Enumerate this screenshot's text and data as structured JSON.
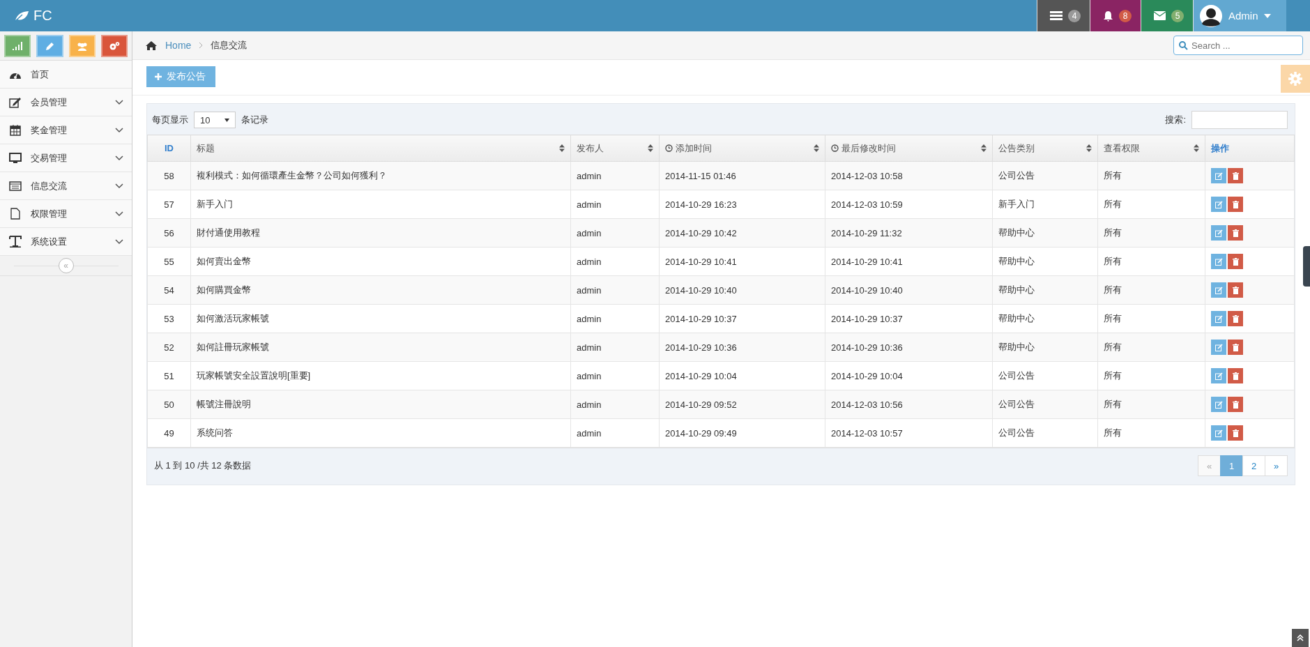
{
  "brand": "FC",
  "topbar": {
    "badges": [
      {
        "count": "4",
        "color": "#555555"
      },
      {
        "count": "8",
        "color": "#8a2463"
      },
      {
        "count": "5",
        "color": "#2a8a5a"
      }
    ],
    "user": "Admin"
  },
  "sidebar": {
    "items": [
      {
        "label": "首页",
        "expandable": false
      },
      {
        "label": "会员管理",
        "expandable": true
      },
      {
        "label": "奖金管理",
        "expandable": true
      },
      {
        "label": "交易管理",
        "expandable": true
      },
      {
        "label": "信息交流",
        "expandable": true
      },
      {
        "label": "权限管理",
        "expandable": true
      },
      {
        "label": "系统设置",
        "expandable": true
      }
    ],
    "collapse": "«"
  },
  "breadcrumb": [
    "Home",
    "信息交流"
  ],
  "search": {
    "placeholder": "Search ..."
  },
  "add_button": "发布公告",
  "table": {
    "length_label": "每页显示",
    "length_value": "10",
    "length_suffix": "条记录",
    "search_label": "搜索:",
    "columns": [
      {
        "label": "ID",
        "kind": "id",
        "sortable": false,
        "clock": false
      },
      {
        "label": "标题",
        "kind": "text",
        "sortable": true,
        "clock": false
      },
      {
        "label": "发布人",
        "kind": "text",
        "sortable": true,
        "clock": false
      },
      {
        "label": "添加时间",
        "kind": "text",
        "sortable": true,
        "clock": true
      },
      {
        "label": "最后修改时间",
        "kind": "text",
        "sortable": true,
        "clock": true
      },
      {
        "label": "公告类别",
        "kind": "text",
        "sortable": true,
        "clock": false
      },
      {
        "label": "查看权限",
        "kind": "text",
        "sortable": true,
        "clock": false
      },
      {
        "label": "操作",
        "kind": "action",
        "sortable": false,
        "clock": false
      }
    ],
    "rows": [
      [
        "58",
        "複利模式：如何循環產生金幣？公司如何獲利？",
        "admin",
        "2014-11-15 01:46",
        "2014-12-03 10:58",
        "公司公告",
        "所有"
      ],
      [
        "57",
        "新手入门",
        "admin",
        "2014-10-29 16:23",
        "2014-12-03 10:59",
        "新手入门",
        "所有"
      ],
      [
        "56",
        "財付通使用教程",
        "admin",
        "2014-10-29 10:42",
        "2014-10-29 11:32",
        "帮助中心",
        "所有"
      ],
      [
        "55",
        "如何賣出金幣",
        "admin",
        "2014-10-29 10:41",
        "2014-10-29 10:41",
        "帮助中心",
        "所有"
      ],
      [
        "54",
        "如何購買金幣",
        "admin",
        "2014-10-29 10:40",
        "2014-10-29 10:40",
        "帮助中心",
        "所有"
      ],
      [
        "53",
        "如何激活玩家帳號",
        "admin",
        "2014-10-29 10:37",
        "2014-10-29 10:37",
        "帮助中心",
        "所有"
      ],
      [
        "52",
        "如何註冊玩家帳號",
        "admin",
        "2014-10-29 10:36",
        "2014-10-29 10:36",
        "帮助中心",
        "所有"
      ],
      [
        "51",
        "玩家帳號安全設置說明[重要]",
        "admin",
        "2014-10-29 10:04",
        "2014-10-29 10:04",
        "公司公告",
        "所有"
      ],
      [
        "50",
        "帳號注冊說明",
        "admin",
        "2014-10-29 09:52",
        "2014-12-03 10:56",
        "公司公告",
        "所有"
      ],
      [
        "49",
        "系统问答",
        "admin",
        "2014-10-29 09:49",
        "2014-12-03 10:57",
        "公司公告",
        "所有"
      ]
    ],
    "info": "从 1 到 10 /共 12 条数据",
    "pages": [
      {
        "label": "«",
        "selected": false,
        "disabled": true
      },
      {
        "label": "1",
        "selected": true,
        "disabled": false
      },
      {
        "label": "2",
        "selected": false,
        "disabled": false
      },
      {
        "label": "»",
        "selected": false,
        "disabled": false
      }
    ]
  }
}
